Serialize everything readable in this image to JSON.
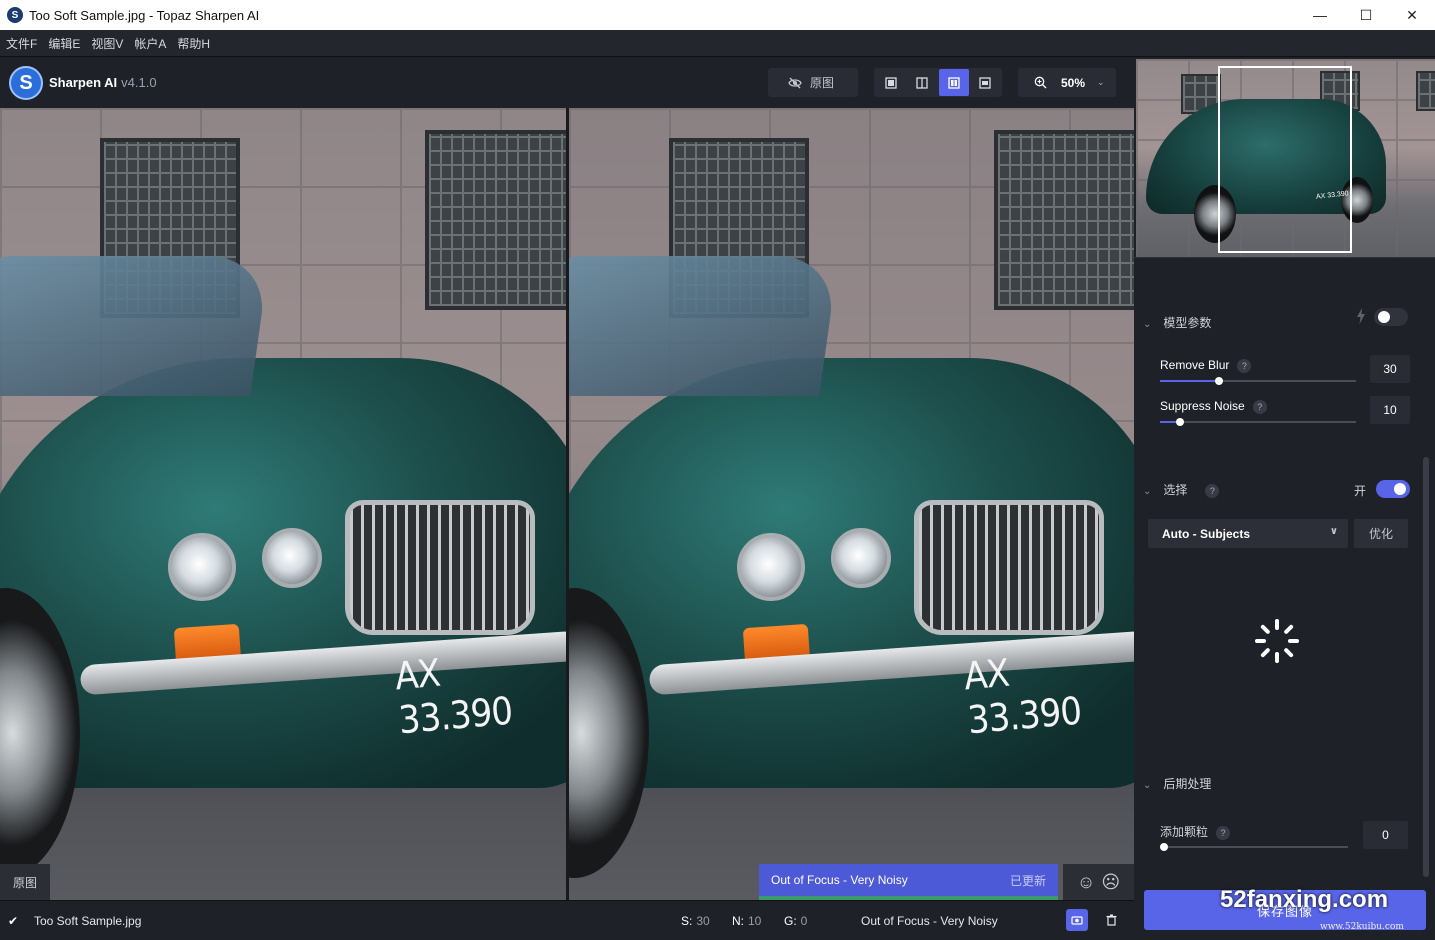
{
  "window": {
    "title": "Too Soft Sample.jpg - Topaz Sharpen AI",
    "minimize": "—",
    "maximize": "☐",
    "close": "✕"
  },
  "menu": [
    "文件F",
    "编辑E",
    "视图V",
    "帐户A",
    "帮助H"
  ],
  "toolbar": {
    "brand_name": "Sharpen AI",
    "version": "v4.1.0",
    "original_label": "原图",
    "zoom": "50%"
  },
  "preview": {
    "left_badge": "原图",
    "plate_text": "AX 33.390",
    "model_tag": "Out of Focus - Very Noisy",
    "model_tag_status": "已更新"
  },
  "status": {
    "filename": "Too Soft Sample.jpg",
    "s_label": "S:",
    "s_value": "30",
    "n_label": "N:",
    "n_value": "10",
    "g_label": "G:",
    "g_value": "0",
    "model": "Out of Focus - Very Noisy"
  },
  "panel": {
    "navigator_plate": "AX 33.390",
    "model_params": {
      "title": "模型参数",
      "auto_toggle": false,
      "remove_blur_label": "Remove Blur",
      "remove_blur_value": "30",
      "remove_blur_fraction": 0.3,
      "suppress_noise_label": "Suppress Noise",
      "suppress_noise_value": "10",
      "suppress_noise_fraction": 0.1
    },
    "selection": {
      "title": "选择",
      "toggle_label": "开",
      "toggle_on": true,
      "mode": "Auto - Subjects",
      "refine_label": "优化"
    },
    "post": {
      "title": "后期处理",
      "grain_label": "添加颗粒",
      "grain_value": "0",
      "grain_fraction": 0.0
    },
    "help": "?",
    "save_label": "保存图像"
  },
  "watermark": {
    "main": "52fanxing.com",
    "sub": "www.52kuibu.com"
  },
  "colors": {
    "accent": "#5865e8",
    "panel_bg": "#1f2129",
    "model_tag_bg": "#4c5ad8"
  }
}
